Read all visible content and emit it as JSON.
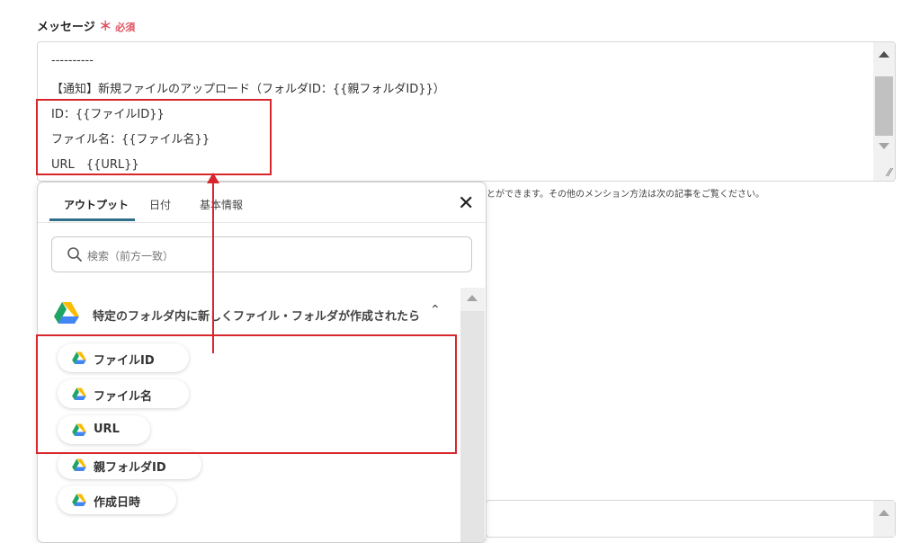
{
  "field": {
    "label": "メッセージ",
    "required_mark": "＊",
    "required_text": "必須"
  },
  "message_lines": [
    "----------",
    "【通知】新規ファイルのアップロード（フォルダID：{{親フォルダID}}）",
    "ID：{{ファイルID}}",
    "ファイル名：{{ファイル名}}",
    "URL　{{URL}}"
  ],
  "help_text": "とができます。その他のメンション方法は次の記事をご覧ください。",
  "popup": {
    "tabs": [
      "アウトプット",
      "日付",
      "基本情報"
    ],
    "active_tab": "アウトプット",
    "close_label": "✕",
    "search_placeholder": "検索（前方一致）",
    "group_title": "特定のフォルダ内に新しくファイル・フォルダが作成されたら",
    "group_chevron": "⌃",
    "items": [
      "ファイルID",
      "ファイル名",
      "URL",
      "親フォルダID",
      "作成日時"
    ]
  },
  "colors": {
    "highlight": "#d7262c",
    "tab_underline": "#2f6f8a",
    "required": "#e05260"
  },
  "icons": {
    "drive": "google-drive-icon",
    "search": "search-icon",
    "close": "close-icon",
    "chevron": "chevron-up-icon"
  }
}
